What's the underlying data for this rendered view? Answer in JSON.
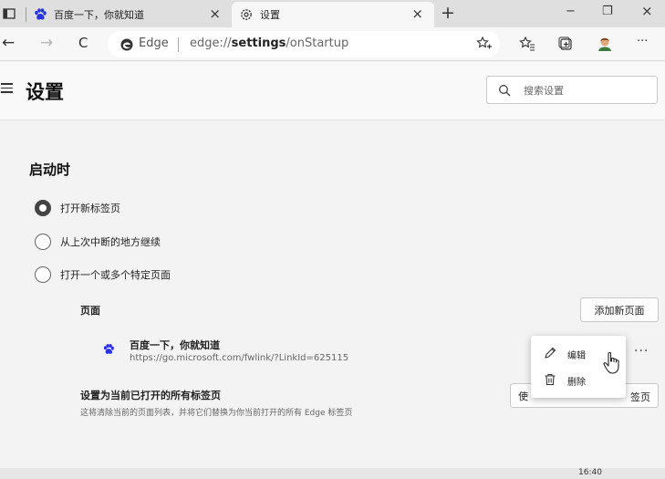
{
  "tabs": [
    {
      "title": "百度一下，你就知道",
      "close": "×"
    },
    {
      "title": "设置",
      "close": "×"
    }
  ],
  "new_tab": "+",
  "window_controls": {
    "minimize": "−",
    "restore": "❐",
    "close": "×"
  },
  "nav": {
    "back": "←",
    "forward": "→",
    "refresh": "C"
  },
  "omnibox": {
    "label": "Edge",
    "url_prefix": "edge://",
    "url_bold": "settings",
    "url_suffix": "/onStartup"
  },
  "toolbar_more": "···",
  "header": {
    "title": "设置",
    "search_placeholder": "搜索设置"
  },
  "startup": {
    "title": "启动时",
    "options": [
      {
        "label": "打开新标签页",
        "checked": true
      },
      {
        "label": "从上次中断的地方继续",
        "checked": false
      },
      {
        "label": "打开一个或多个特定页面",
        "checked": false
      }
    ],
    "pages_label": "页面",
    "add_page_button": "添加新页面",
    "page_entry": {
      "name": "百度一下，你就知道",
      "url": "https://go.microsoft.com/fwlink/?LinkId=625115"
    },
    "more": "···",
    "use_current": {
      "title": "设置为当前已打开的所有标签页",
      "description": "这将清除当前的页面列表，并将它们替换为你当前打开的所有 Edge 标签页",
      "button_left": "使",
      "button_right": "签页"
    }
  },
  "context_menu": {
    "edit": "编辑",
    "delete": "删除"
  },
  "taskbar": {
    "clock": "16:40"
  },
  "colors": {
    "accent_paw": "#2932e1",
    "edge_blue": "#0c7ad6"
  }
}
